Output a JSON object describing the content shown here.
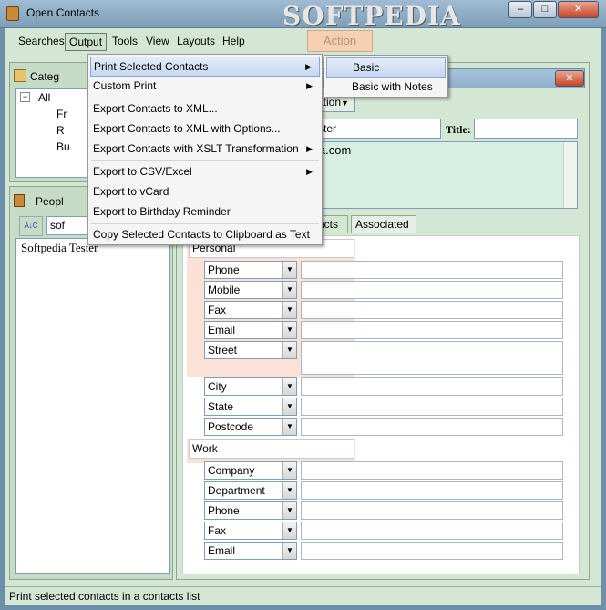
{
  "window": {
    "title": "Open Contacts",
    "watermark": "SOFTPEDIA",
    "minimize": "–",
    "maximize": "□",
    "close": "✕"
  },
  "menubar": {
    "searches": "Searches",
    "output": "Output",
    "tools": "Tools",
    "view": "View",
    "layouts": "Layouts",
    "help": "Help"
  },
  "toolbar": {
    "action": "Action"
  },
  "categories": {
    "title": "Categ",
    "tree_toggle": "−",
    "items": [
      "All",
      "Fr",
      "R",
      "Bu"
    ]
  },
  "people": {
    "title": "Peopl",
    "sort_icon_text": "A↓C",
    "search_value": "sof",
    "list": [
      "Softpedia Tester"
    ]
  },
  "contact": {
    "position_dropdown": "ation",
    "name_value": "ster",
    "title_label": "Title:",
    "title_value": "",
    "notes_value": "ia.com",
    "tabs": [
      "acts",
      "Associated"
    ]
  },
  "personal": {
    "label": "Personal",
    "rows": [
      {
        "type": "Phone",
        "value": ""
      },
      {
        "type": "Mobile",
        "value": ""
      },
      {
        "type": "Fax",
        "value": ""
      },
      {
        "type": "Email",
        "value": ""
      },
      {
        "type": "Street",
        "value": ""
      },
      {
        "type": "City",
        "value": ""
      },
      {
        "type": "State",
        "value": ""
      },
      {
        "type": "Postcode",
        "value": ""
      }
    ]
  },
  "work": {
    "label": "Work",
    "rows": [
      {
        "type": "Company",
        "value": ""
      },
      {
        "type": "Department",
        "value": ""
      },
      {
        "type": "Phone",
        "value": ""
      },
      {
        "type": "Fax",
        "value": ""
      },
      {
        "type": "Email",
        "value": ""
      }
    ]
  },
  "output_menu": {
    "items": [
      "Print Selected Contacts",
      "Custom Print",
      "Export Contacts to XML...",
      "Export Contacts to XML with Options...",
      "Export Contacts with XSLT Transformation",
      "Export to CSV/Excel",
      "Export to vCard",
      "Export to Birthday Reminder",
      "Copy Selected Contacts to Clipboard as Text"
    ]
  },
  "print_submenu": {
    "items": [
      "Basic",
      "Basic with Notes"
    ]
  },
  "statusbar": {
    "text": "Print selected contacts in a contacts list"
  },
  "colors": {
    "frame": "#d4e6d4",
    "peach": "#fbe1d6",
    "highlight": "#c7d8ef",
    "action": "#f6d0b2"
  }
}
